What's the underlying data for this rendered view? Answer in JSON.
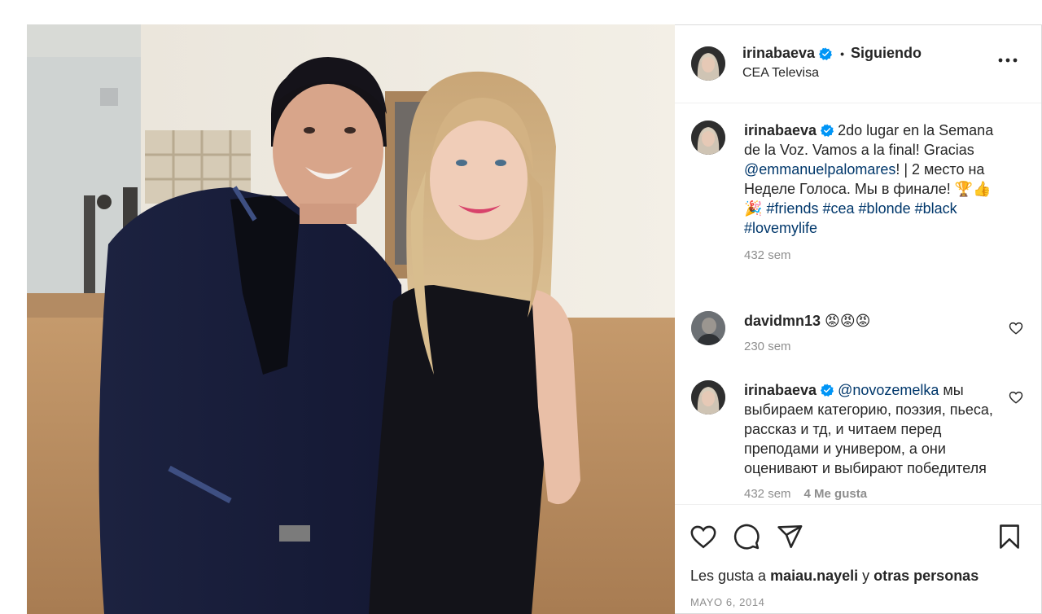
{
  "post": {
    "author": "irinabaeva",
    "follow_state": "Siguiendo",
    "separator": "•",
    "location": "CEA Televisa"
  },
  "caption": {
    "user": "irinabaeva",
    "text_1": " 2do lugar en la Semana de la Voz. Vamos a la final! Gracias ",
    "mention": "@emmanuelpalomares",
    "text_2": "! | 2 место на Неделе Голоса. Мы в финале! 🏆👍🎉 ",
    "hashtags": [
      "#friends",
      "#cea",
      "#blonde",
      "#black",
      "#lovemylife"
    ],
    "time": "432 sem"
  },
  "comments": [
    {
      "user": "davidmn13",
      "text": " 😡😡😡",
      "time": "230 sem"
    },
    {
      "user": "irinabaeva",
      "mention": "@novozemelka",
      "text": " мы выбираем категорию, поэзия, пьеса, рассказ и тд, и читаем перед преподами и универом, а они оценивают и выбирают победителя",
      "time": "432 sem",
      "likes": "4 Me gusta"
    }
  ],
  "likes": {
    "prefix": "Les gusta a ",
    "user": "maiau.nayeli",
    "middle": " y ",
    "others": "otras personas"
  },
  "date": "MAYO 6, 2014",
  "colors": {
    "text": "#262626",
    "secondary": "#8e8e8e",
    "link": "#00376b",
    "verified": "#0095f6",
    "border": "#dbdbdb"
  },
  "icons": [
    "verified-badge-icon",
    "more-options-icon",
    "heart-icon",
    "comment-icon",
    "share-icon",
    "bookmark-icon"
  ]
}
